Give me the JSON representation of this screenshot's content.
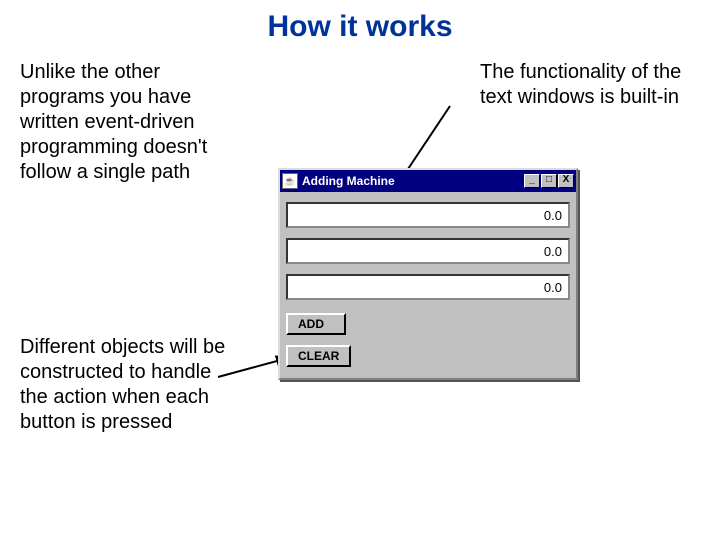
{
  "title": "How it works",
  "paragraphs": {
    "p1": "Unlike the other programs you have written event-driven programming doesn't follow a single path",
    "p2": "The functionality of the text windows is built-in",
    "p3": "Different objects will be constructed to handle the action when each button is pressed"
  },
  "window": {
    "icon_glyph": "☕",
    "title": "Adding Machine",
    "buttons": {
      "min": "_",
      "max": "□",
      "close": "X"
    },
    "fields": [
      "0.0",
      "0.0",
      "0.0"
    ],
    "actions": {
      "add": "ADD",
      "clear": "CLEAR"
    }
  }
}
